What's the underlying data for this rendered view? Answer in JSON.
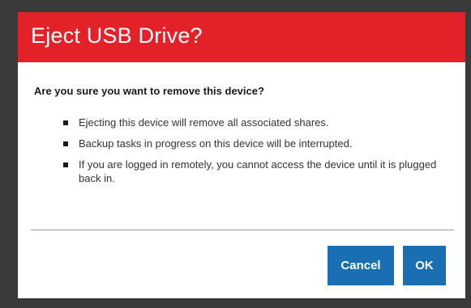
{
  "dialog": {
    "title": "Eject USB Drive?",
    "question": "Are you sure you want to remove this device?",
    "bullets": [
      "Ejecting this device will remove all associated shares.",
      "Backup tasks in progress on this device will be interrupted.",
      "If you are logged in remotely, you cannot access the device until it is plugged back in."
    ],
    "buttons": {
      "cancel": "Cancel",
      "ok": "OK"
    }
  },
  "colors": {
    "header": "#e32129",
    "button": "#1a6fb3",
    "frame": "#3a3a3a"
  }
}
